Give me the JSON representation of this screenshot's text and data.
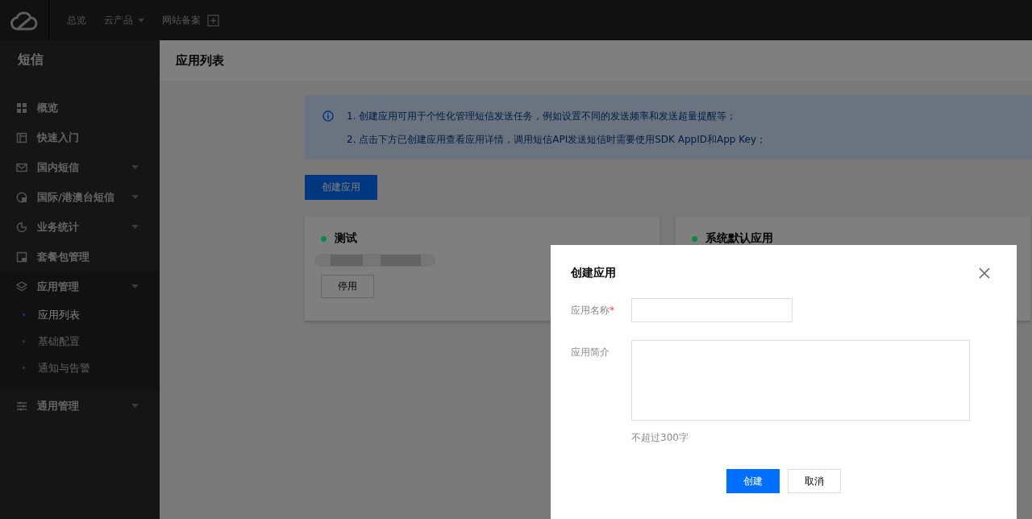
{
  "topbar": {
    "nav": [
      {
        "label": "总览",
        "dropdown": false
      },
      {
        "label": "云产品",
        "dropdown": true
      },
      {
        "label": "网站备案",
        "dropdown": false
      }
    ]
  },
  "sidebar": {
    "title": "短信",
    "items": [
      {
        "label": "概览",
        "expandable": false,
        "expanded": false
      },
      {
        "label": "快速入门",
        "expandable": false,
        "expanded": false
      },
      {
        "label": "国内短信",
        "expandable": true,
        "expanded": false
      },
      {
        "label": "国际/港澳台短信",
        "expandable": true,
        "expanded": false
      },
      {
        "label": "业务统计",
        "expandable": true,
        "expanded": false
      },
      {
        "label": "套餐包管理",
        "expandable": false,
        "expanded": false
      },
      {
        "label": "应用管理",
        "expandable": true,
        "expanded": true,
        "children": [
          {
            "label": "应用列表",
            "selected": true
          },
          {
            "label": "基础配置",
            "selected": false
          },
          {
            "label": "通知与告警",
            "selected": false
          }
        ]
      },
      {
        "label": "通用管理",
        "expandable": true,
        "expanded": false
      }
    ]
  },
  "page": {
    "title": "应用列表",
    "notice": [
      "1. 创建应用可用于个性化管理短信发送任务，例如设置不同的发送频率和发送超量提醒等；",
      "2. 点击下方已创建应用查看应用详情，调用短信API发送短信时需要使用SDK AppID和App Key；"
    ],
    "create_button": "创建应用",
    "apps": [
      {
        "name": "测试",
        "color": "#0b8a43",
        "button": "停用"
      },
      {
        "name": "系统默认应用",
        "color": "#0b8a43"
      }
    ]
  },
  "dialog": {
    "title": "创建应用",
    "fields": [
      {
        "kind": "input",
        "label": "应用名称",
        "required_mark": "*"
      },
      {
        "kind": "textarea",
        "label": "应用简介",
        "hint": "不超过300字"
      }
    ],
    "buttons": [
      {
        "label": "创建",
        "primary": true
      },
      {
        "label": "取消",
        "primary": false
      }
    ]
  }
}
